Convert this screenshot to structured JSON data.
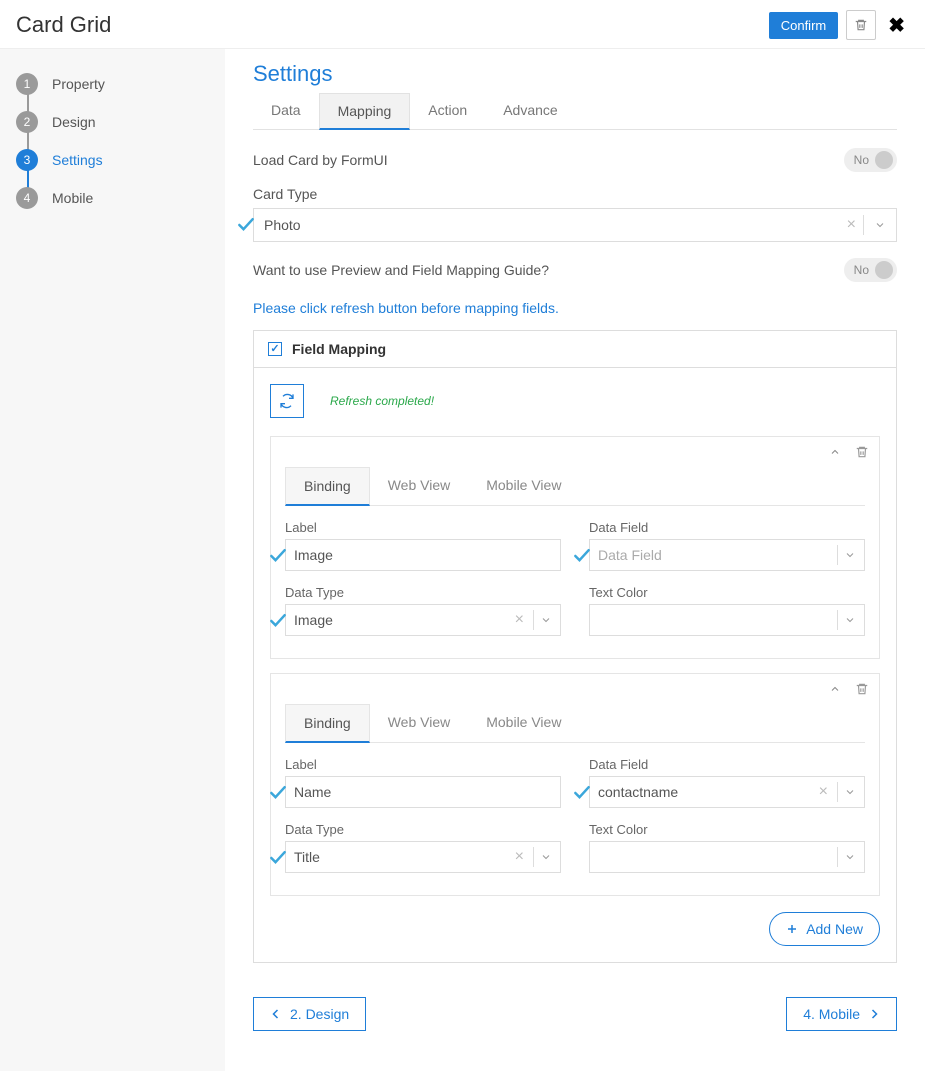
{
  "header": {
    "title": "Card Grid",
    "confirm_label": "Confirm"
  },
  "sidebar": {
    "steps": [
      {
        "num": "1",
        "label": "Property"
      },
      {
        "num": "2",
        "label": "Design"
      },
      {
        "num": "3",
        "label": "Settings"
      },
      {
        "num": "4",
        "label": "Mobile"
      }
    ]
  },
  "settings": {
    "title": "Settings",
    "tabs": [
      "Data",
      "Mapping",
      "Action",
      "Advance"
    ],
    "active_tab": "Mapping",
    "load_card_label": "Load Card by FormUI",
    "load_card_value": "No",
    "card_type_label": "Card Type",
    "card_type_value": "Photo",
    "preview_label": "Want to use Preview and Field Mapping Guide?",
    "preview_value": "No",
    "info_text": "Please click refresh button before mapping fields.",
    "field_mapping_label": "Field Mapping",
    "refresh_status": "Refresh completed!",
    "inner_tabs": [
      "Binding",
      "Web View",
      "Mobile View"
    ],
    "mappings": [
      {
        "label_lbl": "Label",
        "label_val": "Image",
        "data_field_lbl": "Data Field",
        "data_field_val": "Data Field",
        "data_type_lbl": "Data Type",
        "data_type_val": "Image",
        "text_color_lbl": "Text Color",
        "text_color_val": ""
      },
      {
        "label_lbl": "Label",
        "label_val": "Name",
        "data_field_lbl": "Data Field",
        "data_field_val": "contactname",
        "data_type_lbl": "Data Type",
        "data_type_val": "Title",
        "text_color_lbl": "Text Color",
        "text_color_val": ""
      }
    ],
    "add_new_label": "Add New"
  },
  "footer": {
    "prev_label": "2. Design",
    "next_label": "4. Mobile"
  }
}
